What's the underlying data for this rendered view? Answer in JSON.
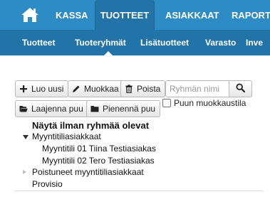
{
  "colors": {
    "nav_bg": "#2d8cc5",
    "nav_active": "#2273a8",
    "subnav_bg": "#2273a8"
  },
  "topnav": {
    "home_icon": "home-icon",
    "tabs": [
      {
        "label": "KASSA"
      },
      {
        "label": "TUOTTEET",
        "active": true
      },
      {
        "label": "ASIAKKAAT"
      },
      {
        "label": "RAPORTO"
      }
    ]
  },
  "subnav": {
    "items": [
      {
        "label": "Tuotteet"
      },
      {
        "label": "Tuoteryhmät",
        "active": true
      },
      {
        "label": "Lisätuotteet"
      },
      {
        "label": "Varasto"
      },
      {
        "label": "Inve"
      }
    ]
  },
  "toolbar": {
    "new_label": "Luo uusi",
    "edit_label": "Muokkaa",
    "delete_label": "Poista",
    "search_placeholder": "Ryhmän nimi",
    "expand_label": "Laajenna puu",
    "collapse_label": "Pienennä puu",
    "checkbox_label": "Puun muokkaustila"
  },
  "tree": {
    "show_ungrouped": "Näytä ilman ryhmää olevat",
    "groups": [
      {
        "label": "Myyntitiliasiakkaat",
        "expanded": true
      },
      {
        "label": "Myyntitili 01 Tiina Testiasiakas"
      },
      {
        "label": "Myyntitili 02 Tero Testiasiakas"
      },
      {
        "label": "Poistuneet myyntitiliasiakkaat",
        "expanded": false
      },
      {
        "label": "Provisio"
      }
    ]
  }
}
